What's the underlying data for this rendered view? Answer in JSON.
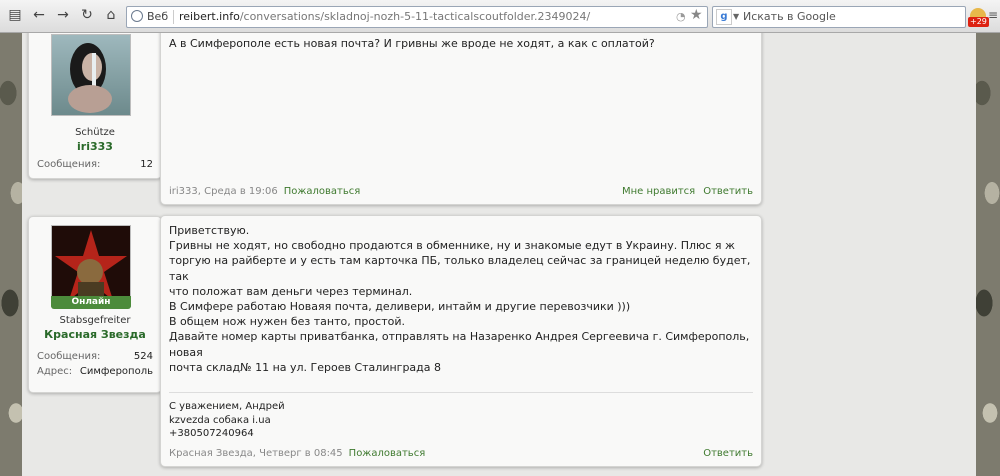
{
  "browser": {
    "url_tag": "Веб",
    "url_host": "reibert.info",
    "url_path": "/conversations/skladnoj-nozh-5-11-tacticalscoutfolder.2349024/",
    "search_placeholder": "Искать в Google",
    "ext_badge": "+29"
  },
  "posts": [
    {
      "user": {
        "title": "Schütze",
        "name": "iri333",
        "stats": [
          {
            "label": "Сообщения:",
            "value": "12"
          }
        ]
      },
      "message": "А в Симферополе есть новая почта? И гривны же вроде не ходят, а как с оплатой?",
      "meta": {
        "author_date": "iri333, Среда в 19:06",
        "report": "Пожаловаться"
      },
      "actions": [
        "Мне нравится",
        "Ответить"
      ]
    },
    {
      "user": {
        "online": "Онлайн",
        "title": "Stabsgefreiter",
        "name": "Красная Звезда",
        "stats": [
          {
            "label": "Сообщения:",
            "value": "524"
          },
          {
            "label": "Адрес:",
            "value": "Симферополь"
          }
        ]
      },
      "message": "Приветствую.\nГривны не ходят, но свободно продаются в обменнике, ну и знакомые едут в Украину. Плюс я ж\nторгую на райберте и у есть там карточка ПБ, только владелец сейчас за границей неделю будет, так\nчто положат вам деньги через терминал.\nВ Симфере работаю Новаяя почта, деливери, интайм и другие перевозчики )))\nВ общем нож нужен без танто, простой.\nДавайте номер карты приватбанка, отправлять на Назаренко Андрея Сергеевича г. Симферополь, новая\nпочта склад№ 11 на ул. Героев Сталинграда 8",
      "signature": [
        "С уважением, Андрей",
        "kzvezda собака i.ua",
        "+380507240964"
      ],
      "meta": {
        "author_date": "Красная Звезда, Четверг в 08:45",
        "report": "Пожаловаться"
      },
      "actions": [
        "Ответить"
      ]
    }
  ]
}
